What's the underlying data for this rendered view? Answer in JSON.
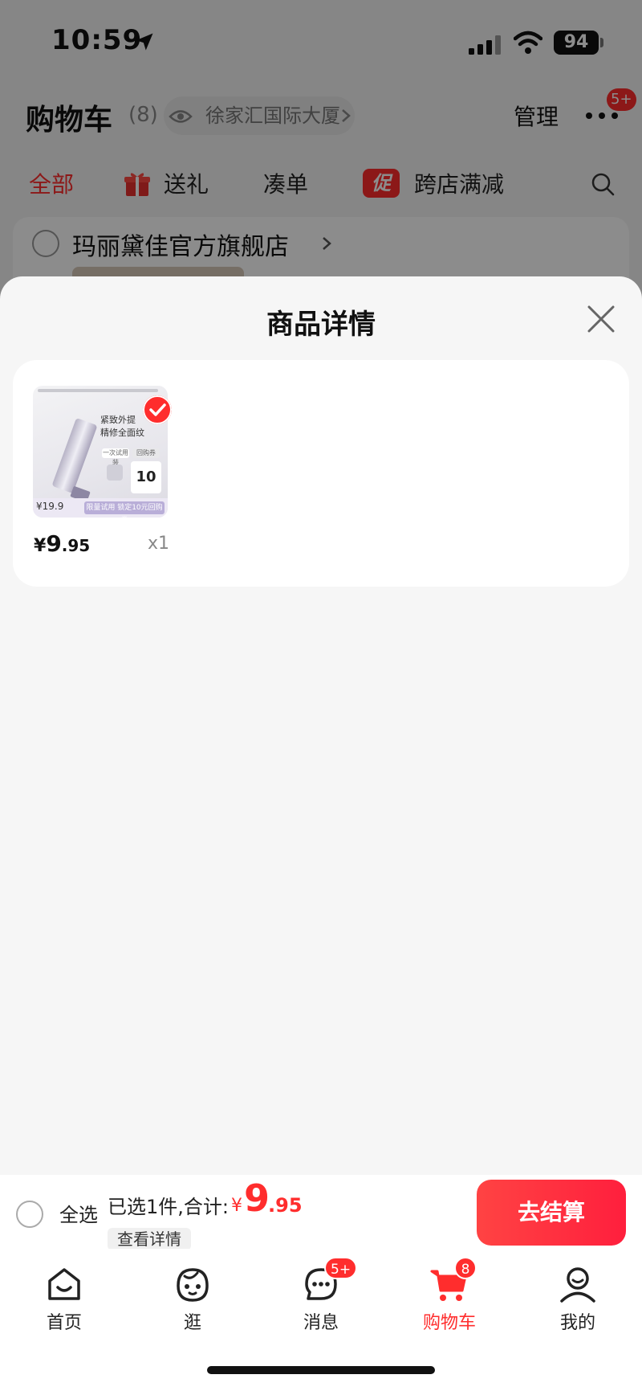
{
  "status_bar": {
    "time": "10:59",
    "battery": "94"
  },
  "header": {
    "title": "购物车",
    "count": "(8)",
    "address": "徐家汇国际大厦",
    "manage": "管理",
    "more_badge": "5+"
  },
  "filters": {
    "tabs": [
      "全部",
      "送礼",
      "凑单",
      "跨店满减"
    ],
    "promo_badge": "促"
  },
  "store": {
    "name": "玛丽黛佳官方旗舰店"
  },
  "sheet": {
    "title": "商品详情",
    "product": {
      "image_text": {
        "line1": "紧致外提",
        "line2": "精修全面纹",
        "chip1": "一次试用装",
        "chip2": "回购券",
        "coupon": "10",
        "price_tag": "¥19.9",
        "promo": "限量试用 锁定10元回购券"
      },
      "price_symbol": "¥",
      "price_int": "9",
      "price_dec": ".95",
      "qty": "x1"
    }
  },
  "checkout": {
    "select_all": "全选",
    "summary": "已选1件,合计:",
    "total_symbol": "¥",
    "total_int": "9",
    "total_dec": ".95",
    "details": "查看详情",
    "button": "去结算"
  },
  "tabbar": {
    "items": [
      {
        "label": "首页"
      },
      {
        "label": "逛"
      },
      {
        "label": "消息",
        "badge": "5+"
      },
      {
        "label": "购物车",
        "badge": "8"
      },
      {
        "label": "我的"
      }
    ]
  },
  "colors": {
    "accent": "#ff2d2d",
    "sheet_bg": "#f6f6f6"
  }
}
